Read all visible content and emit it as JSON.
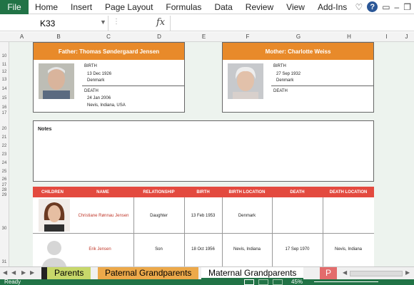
{
  "ribbon": {
    "file": "File",
    "menu": [
      "Home",
      "Insert",
      "Page Layout",
      "Formulas",
      "Data",
      "Review",
      "View",
      "Add-Ins"
    ]
  },
  "formula_bar": {
    "name_box": "K33",
    "fx": "fx",
    "formula": ""
  },
  "columns": [
    "A",
    "B",
    "C",
    "D",
    "E",
    "F",
    "G",
    "H",
    "I",
    "J"
  ],
  "rows": [
    "10",
    "11",
    "12",
    "13",
    "14",
    "15",
    "16",
    "17",
    "20",
    "21",
    "22",
    "23",
    "24",
    "25",
    "26",
    "27",
    "28",
    "29",
    "30",
    "31"
  ],
  "father": {
    "title": "Father: Thomas Søndergaard Jensen",
    "birth_label": "BIRTH",
    "birth_date": "13 Dec 1926",
    "birth_place": "Denmark",
    "death_label": "DEATH",
    "death_date": "24 Jan 2006",
    "death_place": "Nevis, Indiana, USA"
  },
  "mother": {
    "title": "Mother: Charlotte Weiss",
    "birth_label": "BIRTH",
    "birth_date": "27 Sep 1932",
    "birth_place": "Denmark",
    "death_label": "DEATH"
  },
  "notes": {
    "label": "Notes"
  },
  "children_table": {
    "headers": [
      "CHILDREN",
      "NAME",
      "RELATIONSHIP",
      "BIRTH",
      "BIRTH LOCATION",
      "DEATH",
      "DEATH LOCATION"
    ],
    "rows": [
      {
        "name": "Christiane Rønnau Jensen",
        "relationship": "Daughter",
        "birth": "13 Feb 1953",
        "birth_location": "Denmark",
        "death": "",
        "death_location": ""
      },
      {
        "name": "Erik Jensen",
        "relationship": "Son",
        "birth": "18 Oct 1956",
        "birth_location": "Nevis, Indiana",
        "death": "17 Sep 1970",
        "death_location": "Nevis, Indiana"
      }
    ]
  },
  "sheet_tabs": [
    "Parents",
    "Paternal Grandparents",
    "Maternal Grandparents",
    "P"
  ],
  "active_tab": "Maternal Grandparents",
  "status": {
    "text": "Ready",
    "zoom": "45%"
  },
  "colors": {
    "accent_green": "#217346",
    "card_header": "#e88a2a",
    "table_header": "#e34a3f",
    "name_text": "#c0392b"
  }
}
